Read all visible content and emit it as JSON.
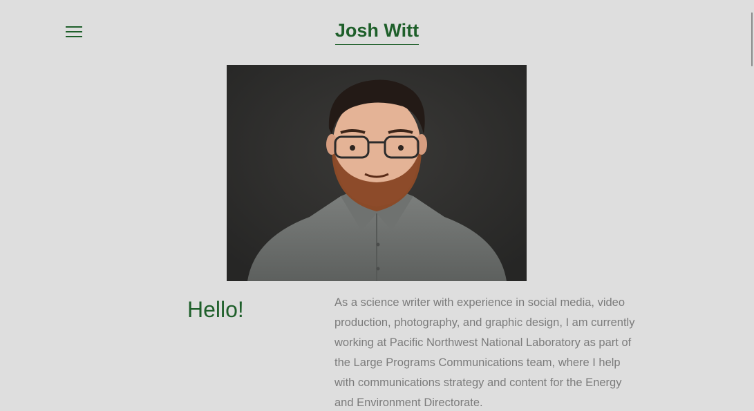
{
  "header": {
    "title": "Josh Witt",
    "menu_icon": "hamburger-menu-icon"
  },
  "hero": {
    "image_name": "portrait-photo"
  },
  "intro": {
    "heading": "Hello!",
    "body": "As a science writer with experience in social media, video production, photography, and graphic design, I am currently working at Pacific Northwest National Laboratory as part of the Large Programs Communications team, where I help with communications strategy and content for the Energy and Environment Directorate."
  },
  "colors": {
    "background": "#dedede",
    "accent_green": "#1e5f2a",
    "body_text": "#7b7b7b"
  }
}
